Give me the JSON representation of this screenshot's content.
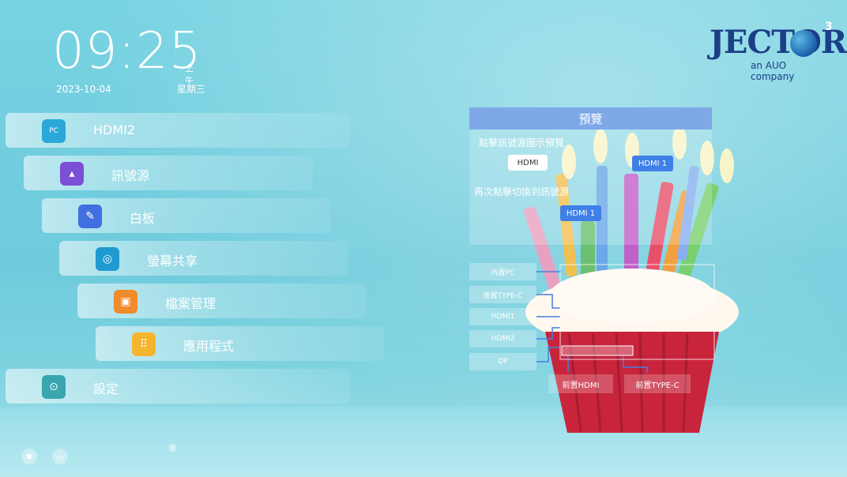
{
  "clock": {
    "time": "09:25",
    "ampm": "上午",
    "date": "2023-10-04",
    "weekday": "星期三"
  },
  "logo": {
    "brand": "JECTOR",
    "superscript": "3",
    "tagline": "an AUO company",
    "color": "#1a3f86"
  },
  "menu": {
    "items": [
      {
        "label": "HDMI2",
        "icon": "pc-icon",
        "icon_text": "PC",
        "icon_color": "#2aa8d8"
      },
      {
        "label": "訊號源",
        "icon": "signal-source-icon",
        "icon_color": "#7b4fd6"
      },
      {
        "label": "白板",
        "icon": "whiteboard-icon",
        "icon_color": "#3f6fe0"
      },
      {
        "label": "螢幕共享",
        "icon": "screen-share-icon",
        "icon_color": "#1f9ad0"
      },
      {
        "label": "檔案管理",
        "icon": "file-manager-icon",
        "icon_color": "#f08a2a"
      },
      {
        "label": "應用程式",
        "icon": "apps-icon",
        "icon_color": "#f5b52e"
      },
      {
        "label": "設定",
        "icon": "settings-icon",
        "icon_color": "#3aa5ad"
      }
    ]
  },
  "status_bar": {
    "icons": [
      "bluetooth-icon",
      "monitor-icon",
      "snowflake-icon"
    ]
  },
  "preview": {
    "title": "預覽",
    "instruction_1": "點擊訊號源圖示預覽",
    "instruction_2": "再次點擊切換到訊號源",
    "chip_a": "HDMI",
    "chip_b": "HDMI 1",
    "chip_c": "HDMI 1"
  },
  "ports": {
    "side": [
      "內置PC",
      "後置TYPE-C",
      "HDMI1",
      "HDMI2",
      "DP"
    ],
    "front": [
      "前置HDMI",
      "前置TYPE-C"
    ]
  }
}
